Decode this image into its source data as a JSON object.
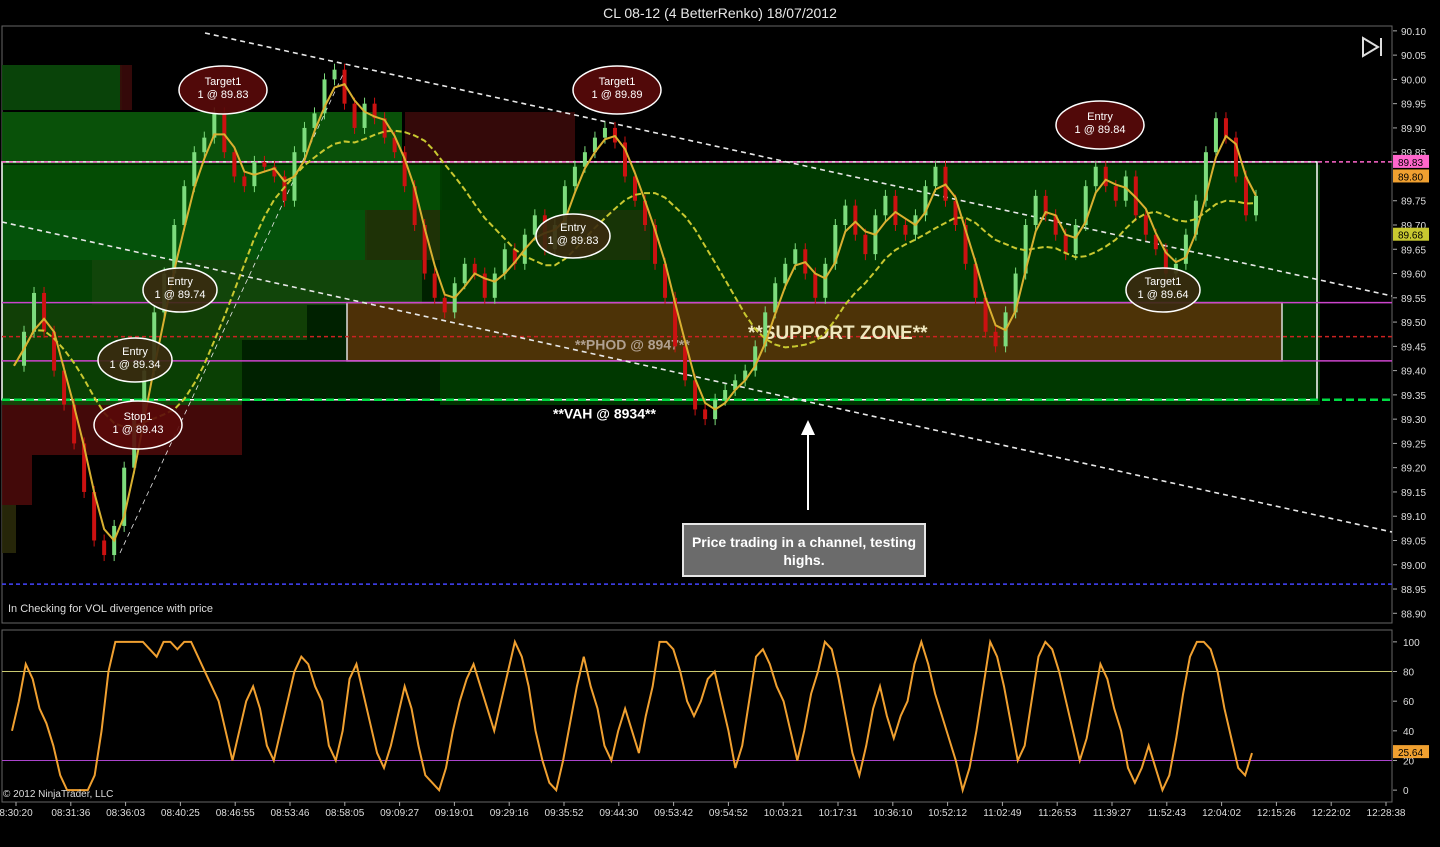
{
  "window": {
    "title": "CL 08-12 (4 BetterRenko)  18/07/2012",
    "copyright": "© 2012 NinjaTrader, LLC",
    "indicator_note": "In  Checking for VOL  divergence with price",
    "callout": "Price trading in a channel, testing highs."
  },
  "colors": {
    "up_bar": "#7ddc7d",
    "down_bar": "#cc1111",
    "ma_fast": "#d9b030",
    "ma_slow": "#c8c830",
    "oscillator": "#f0a030",
    "zone_green": "#003c00",
    "support_zone": "#5a3208",
    "value_area": "#00dd44"
  },
  "chart_data": [
    {
      "type": "line",
      "title": "CL 08-12 (4 BetterRenko)  18/07/2012",
      "ylim": [
        88.88,
        90.11
      ],
      "yticks": [
        "90.10",
        "90.05",
        "90.00",
        "89.95",
        "89.90",
        "89.85",
        "89.80",
        "89.75",
        "89.70",
        "89.65",
        "89.60",
        "89.55",
        "89.50",
        "89.45",
        "89.40",
        "89.35",
        "89.30",
        "89.25",
        "89.20",
        "89.15",
        "89.10",
        "89.05",
        "89.00",
        "88.95",
        "88.90"
      ],
      "xticks": [
        "8:30:20",
        "08:31:36",
        "08:36:03",
        "08:40:25",
        "08:46:55",
        "08:53:46",
        "08:58:05",
        "09:09:27",
        "09:19:01",
        "09:29:16",
        "09:35:52",
        "09:44:30",
        "09:53:42",
        "09:54:52",
        "10:03:21",
        "10:17:31",
        "10:36:10",
        "10:52:12",
        "11:02:49",
        "11:26:53",
        "11:39:27",
        "11:52:43",
        "12:04:02",
        "12:15:26",
        "12:22:02",
        "12:28:38"
      ],
      "price_labels": [
        {
          "text": "89.83",
          "value": 89.83,
          "color": "#ff66cc"
        },
        {
          "text": "89.80",
          "value": 89.8,
          "color": "#f0a030"
        },
        {
          "text": "89.68",
          "value": 89.68,
          "color": "#c8c830"
        }
      ],
      "close_path": [
        89.41,
        89.48,
        89.56,
        89.48,
        89.4,
        89.33,
        89.25,
        89.15,
        89.05,
        89.02,
        89.08,
        89.2,
        89.3,
        89.4,
        89.52,
        89.6,
        89.7,
        89.78,
        89.85,
        89.88,
        89.93,
        89.85,
        89.8,
        89.78,
        89.83,
        89.82,
        89.8,
        89.75,
        89.85,
        89.9,
        89.93,
        90.0,
        90.02,
        89.95,
        89.9,
        89.95,
        89.92,
        89.88,
        89.85,
        89.78,
        89.7,
        89.6,
        89.55,
        89.52,
        89.58,
        89.62,
        89.6,
        89.55,
        89.6,
        89.65,
        89.62,
        89.68,
        89.72,
        89.65,
        89.7,
        89.78,
        89.82,
        89.85,
        89.88,
        89.9,
        89.87,
        89.8,
        89.75,
        89.7,
        89.62,
        89.55,
        89.45,
        89.38,
        89.32,
        89.3,
        89.34,
        89.36,
        89.38,
        89.4,
        89.45,
        89.52,
        89.58,
        89.62,
        89.65,
        89.6,
        89.55,
        89.62,
        89.7,
        89.74,
        89.68,
        89.64,
        89.72,
        89.76,
        89.7,
        89.68,
        89.72,
        89.78,
        89.82,
        89.75,
        89.7,
        89.62,
        89.55,
        89.48,
        89.45,
        89.52,
        89.6,
        89.7,
        89.76,
        89.72,
        89.68,
        89.64,
        89.7,
        89.78,
        89.82,
        89.78,
        89.75,
        89.8,
        89.72,
        89.68,
        89.65,
        89.6,
        89.62,
        89.68,
        89.75,
        89.85,
        89.92,
        89.88,
        89.8,
        89.72,
        89.76
      ],
      "levels": [
        {
          "name": "",
          "value": 89.83,
          "color": "#ff66cc"
        },
        {
          "name": "",
          "value": 89.54,
          "color": "#cc44cc"
        },
        {
          "name": "",
          "value": 89.42,
          "color": "#cc44cc"
        },
        {
          "name": "**PHOD @ 8947**",
          "value": 89.47,
          "color": "#cc2222"
        },
        {
          "name": "**VAH @ 8934**",
          "value": 89.34,
          "color": "#00dd44"
        },
        {
          "name": "",
          "value": 88.96,
          "color": "#4444ff"
        }
      ],
      "zones": [
        {
          "label": "",
          "top": 89.83,
          "bottom": 89.34
        },
        {
          "label": "**SUPPORT ZONE**",
          "top": 89.54,
          "bottom": 89.42
        }
      ],
      "trade_markers": [
        {
          "label": "Target1",
          "detail": "1 @ 89.83",
          "dark": true
        },
        {
          "label": "Target1",
          "detail": "1 @ 89.89",
          "dark": true
        },
        {
          "label": "Entry",
          "detail": "1 @ 89.84",
          "dark": true
        },
        {
          "label": "Entry",
          "detail": "1 @ 89.83",
          "dark": false
        },
        {
          "label": "Entry",
          "detail": "1 @ 89.74",
          "dark": false
        },
        {
          "label": "Entry",
          "detail": "1 @ 89.34",
          "dark": false
        },
        {
          "label": "Stop1",
          "detail": "1 @ 89.43",
          "dark": true
        },
        {
          "label": "Target1",
          "detail": "1 @ 89.64",
          "dark": false
        }
      ]
    },
    {
      "type": "line",
      "title": "",
      "ylim": [
        -8,
        108
      ],
      "yticks": [
        "100",
        "80",
        "60",
        "40",
        "20",
        "0"
      ],
      "last_value": "25.64",
      "levels": [
        80,
        20
      ],
      "values": [
        40,
        60,
        85,
        75,
        55,
        45,
        30,
        10,
        0,
        0,
        0,
        0,
        10,
        40,
        80,
        100,
        100,
        100,
        100,
        100,
        95,
        90,
        100,
        100,
        95,
        100,
        100,
        90,
        80,
        70,
        60,
        40,
        20,
        40,
        60,
        70,
        55,
        30,
        20,
        40,
        60,
        80,
        90,
        85,
        70,
        60,
        30,
        20,
        40,
        75,
        85,
        65,
        45,
        25,
        15,
        30,
        50,
        70,
        55,
        30,
        10,
        5,
        0,
        15,
        40,
        60,
        75,
        85,
        70,
        55,
        40,
        60,
        80,
        100,
        90,
        70,
        40,
        20,
        5,
        0,
        20,
        45,
        70,
        90,
        70,
        55,
        30,
        20,
        40,
        55,
        40,
        25,
        50,
        70,
        100,
        100,
        95,
        80,
        60,
        50,
        60,
        75,
        80,
        60,
        40,
        15,
        30,
        60,
        90,
        95,
        85,
        70,
        60,
        40,
        20,
        40,
        65,
        80,
        100,
        95,
        75,
        50,
        25,
        10,
        30,
        55,
        70,
        50,
        35,
        50,
        60,
        85,
        100,
        85,
        65,
        50,
        35,
        20,
        0,
        15,
        40,
        70,
        100,
        90,
        70,
        45,
        20,
        30,
        60,
        90,
        100,
        95,
        80,
        60,
        40,
        20,
        35,
        60,
        85,
        75,
        55,
        40,
        15,
        5,
        15,
        30,
        15,
        0,
        10,
        35,
        65,
        90,
        100,
        100,
        95,
        80,
        55,
        35,
        15,
        10,
        25
      ]
    }
  ]
}
